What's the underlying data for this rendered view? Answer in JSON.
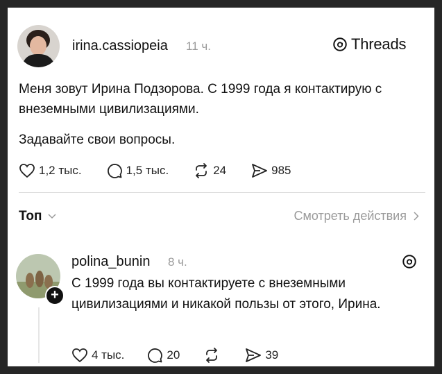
{
  "post": {
    "username": "irina.cassiopeia",
    "time": "11 ч.",
    "brand": "Threads",
    "text": "Меня зовут Ирина Подзорова. С 1999 года я контактирую с внеземными цивилизациями.",
    "text2": "Задавайте свои вопросы.",
    "likes": "1,2 тыс.",
    "replies": "1,5 тыс.",
    "reposts": "24",
    "shares": "985"
  },
  "sort": {
    "label": "Топ",
    "view_activity": "Смотреть действия"
  },
  "reply": {
    "username": "polina_bunin",
    "time": "8 ч.",
    "text": "С 1999 года вы контактируете с внеземными цивилизациями и никакой пользы от этого, Ирина.",
    "likes": "4 тыс.",
    "replies": "20",
    "shares": "39"
  },
  "colors": {
    "muted": "#9a9a9a",
    "text": "#111111",
    "frame": "#262626"
  }
}
